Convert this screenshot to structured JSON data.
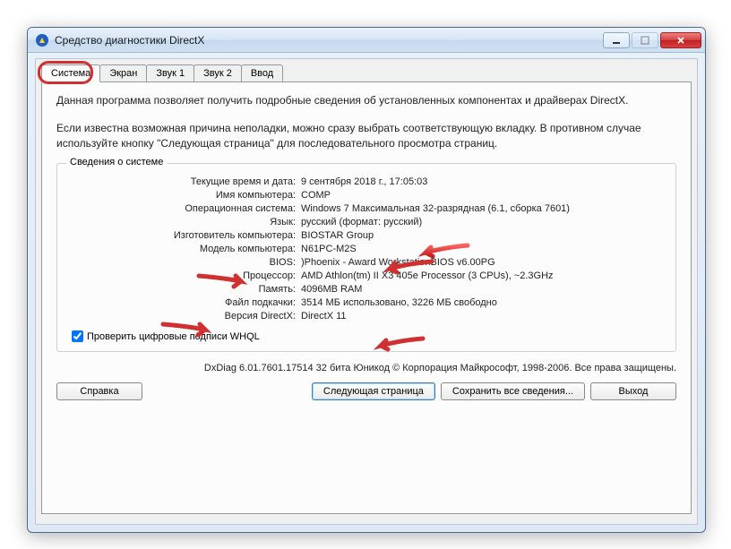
{
  "window": {
    "title": "Средство диагностики DirectX"
  },
  "tabs": {
    "system": "Система",
    "display": "Экран",
    "sound1": "Звук 1",
    "sound2": "Звук 2",
    "input": "Ввод"
  },
  "desc": {
    "p1": "Данная программа позволяет получить подробные сведения об установленных компонентах и драйверах DirectX.",
    "p2": "Если известна возможная причина неполадки, можно сразу выбрать соответствующую вкладку. В противном случае используйте кнопку \"Следующая страница\" для последовательного просмотра страниц."
  },
  "fieldset": {
    "legend": "Сведения о системе",
    "rows": {
      "datetime": {
        "label": "Текущие время и дата:",
        "value": "9 сентября 2018 г., 17:05:03"
      },
      "computer_name": {
        "label": "Имя компьютера:",
        "value": "COMP"
      },
      "os": {
        "label": "Операционная система:",
        "value": "Windows 7 Максимальная 32-разрядная (6.1, сборка 7601)"
      },
      "language": {
        "label": "Язык:",
        "value": "русский (формат: русский)"
      },
      "manufacturer": {
        "label": "Изготовитель компьютера:",
        "value": "BIOSTAR Group"
      },
      "model": {
        "label": "Модель компьютера:",
        "value": "N61PC-M2S"
      },
      "bios": {
        "label": "BIOS:",
        "value": ")Phoenix - Award WorkstationBIOS v6.00PG"
      },
      "processor": {
        "label": "Процессор:",
        "value": "AMD Athlon(tm) II X3 405e Processor (3 CPUs), ~2.3GHz"
      },
      "memory": {
        "label": "Память:",
        "value": "4096MB RAM"
      },
      "pagefile": {
        "label": "Файл подкачки:",
        "value": "3514 МБ использовано, 3226 МБ свободно"
      },
      "dxversion": {
        "label": "Версия DirectX:",
        "value": "DirectX 11"
      }
    }
  },
  "checkbox": {
    "label": "Проверить цифровые подписи WHQL",
    "checked": true
  },
  "footer": {
    "diag_line": "DxDiag 6.01.7601.17514 32 бита Юникод   © Корпорация Майкрософт, 1998-2006.  Все права защищены."
  },
  "buttons": {
    "help": "Справка",
    "next": "Следующая страница",
    "save": "Сохранить все сведения...",
    "exit": "Выход"
  }
}
